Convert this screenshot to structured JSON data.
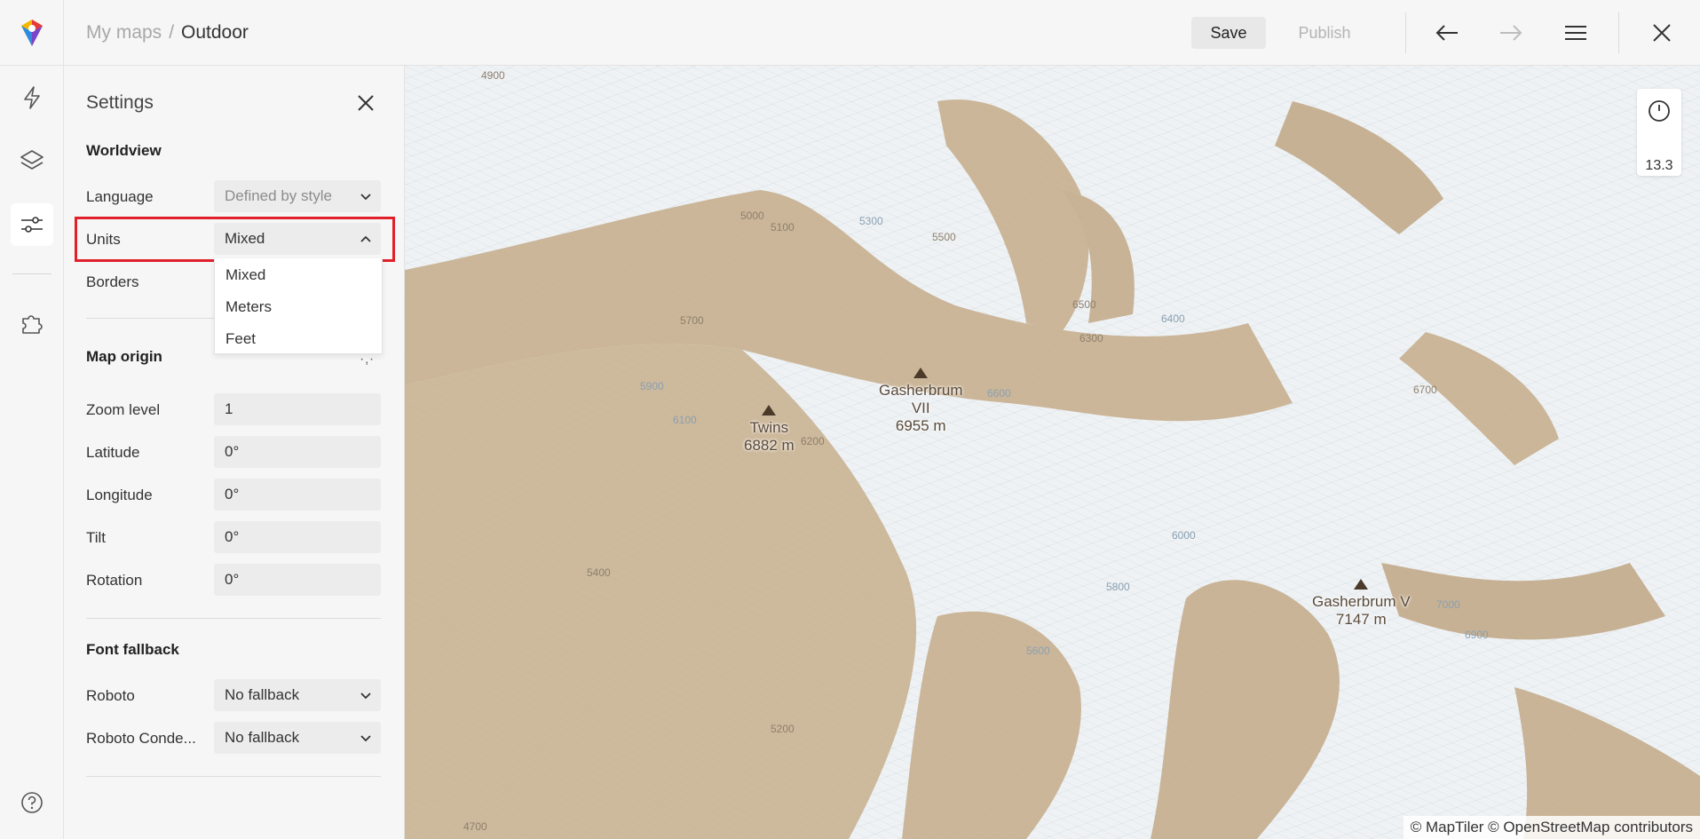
{
  "topbar": {
    "breadcrumb_parent": "My maps",
    "breadcrumb_sep": "/",
    "breadcrumb_current": "Outdoor",
    "save_label": "Save",
    "publish_label": "Publish"
  },
  "rail": {
    "items": [
      "bolt-icon",
      "layers-icon",
      "sliders-icon",
      "puzzle-icon",
      "help-icon"
    ],
    "active": "sliders-icon"
  },
  "settings": {
    "title": "Settings",
    "worldview": {
      "title": "Worldview",
      "language_label": "Language",
      "language_value": "Defined by style",
      "units_label": "Units",
      "units_value": "Mixed",
      "units_options": [
        "Mixed",
        "Meters",
        "Feet"
      ],
      "borders_label": "Borders"
    },
    "map_origin": {
      "title": "Map origin",
      "zoom_label": "Zoom level",
      "zoom_value": "1",
      "lat_label": "Latitude",
      "lat_value": "0°",
      "lon_label": "Longitude",
      "lon_value": "0°",
      "tilt_label": "Tilt",
      "tilt_value": "0°",
      "rotation_label": "Rotation",
      "rotation_value": "0°"
    },
    "font_fallback": {
      "title": "Font fallback",
      "roboto_label": "Roboto",
      "roboto_value": "No fallback",
      "roboto_condensed_label": "Roboto Conde...",
      "roboto_condensed_value": "No fallback"
    }
  },
  "map": {
    "zoom_readout": "13.3",
    "attribution": "© MapTiler © OpenStreetMap contributors",
    "peaks": [
      {
        "name": "Twins",
        "elev": "6882 m"
      },
      {
        "name": "Gasherbrum",
        "name2": "VII",
        "elev": "6955 m"
      },
      {
        "name": "Gasherbrum V",
        "elev": "7147 m"
      }
    ],
    "contours": [
      "4900",
      "5000",
      "5100",
      "5300",
      "5500",
      "5700",
      "5900",
      "6100",
      "6200",
      "6300",
      "6400",
      "6500",
      "6600",
      "6700",
      "6000",
      "5800",
      "5600",
      "5400",
      "5200",
      "4700",
      "6900",
      "7000"
    ]
  },
  "colors": {
    "accent_red": "#e0212b",
    "terrain_tan": "#c9b499",
    "glacier_blue": "#c7d5de"
  }
}
